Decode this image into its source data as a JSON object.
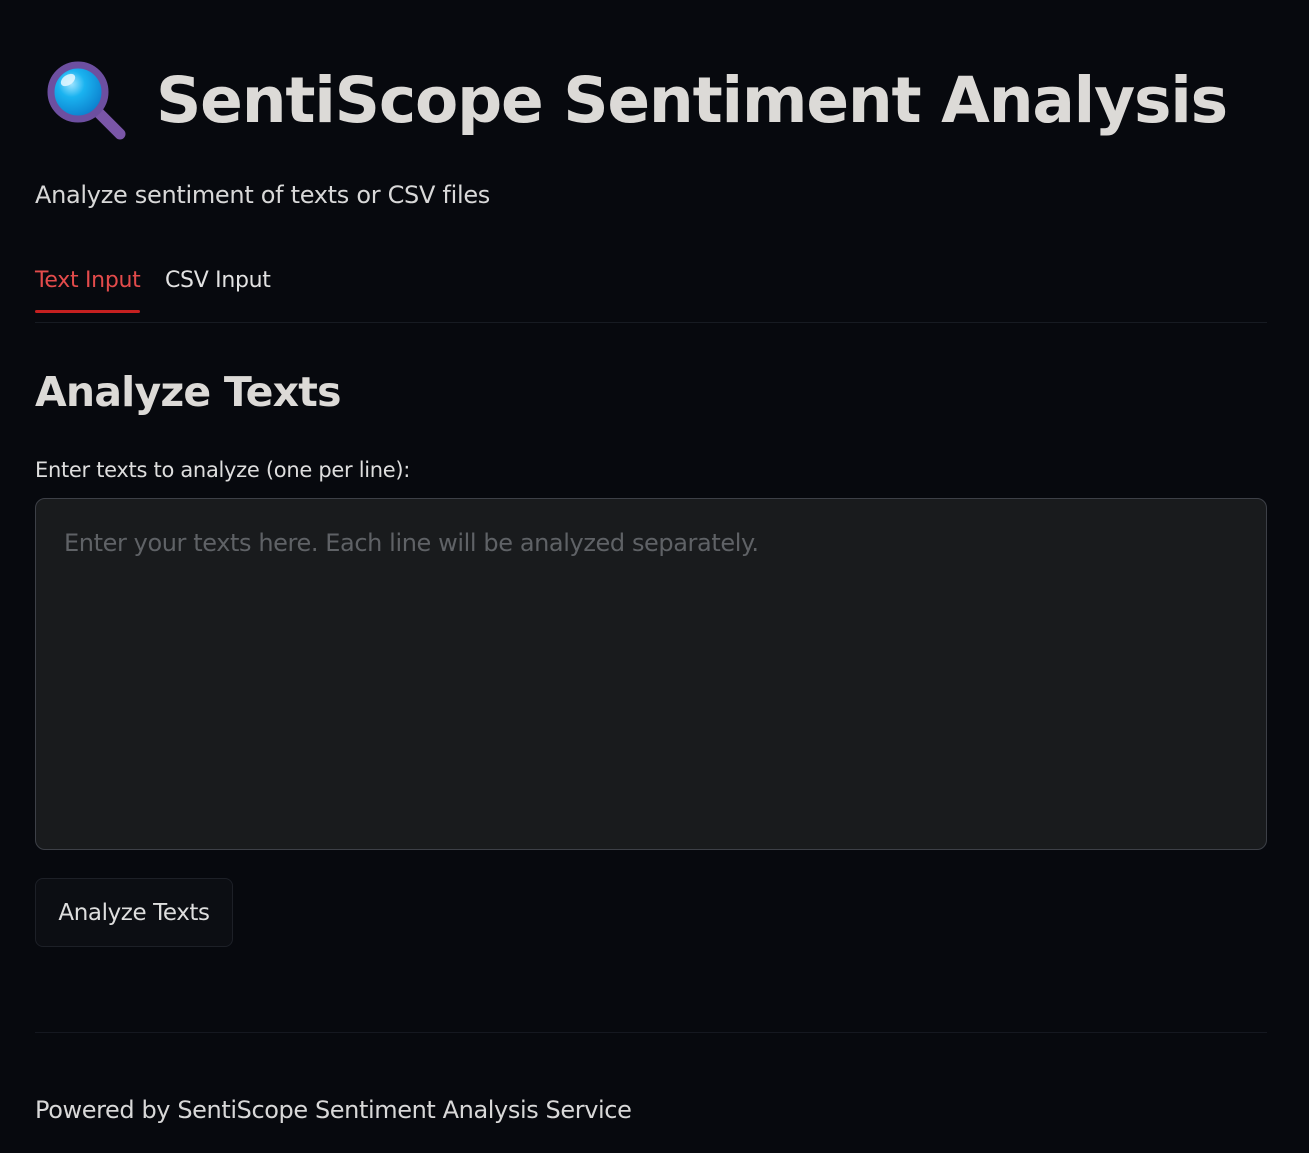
{
  "header": {
    "icon": "magnifying-glass-icon",
    "title": "SentiScope Sentiment Analysis",
    "subtitle": "Analyze sentiment of texts or CSV files"
  },
  "tabs": [
    {
      "label": "Text Input",
      "active": true
    },
    {
      "label": "CSV Input",
      "active": false
    }
  ],
  "main": {
    "heading": "Analyze Texts",
    "input_label": "Enter texts to analyze (one per line):",
    "input_value": "",
    "input_placeholder": "Enter your texts here. Each line will be analyzed separately.",
    "submit_label": "Analyze Texts"
  },
  "footer": {
    "text": "Powered by SentiScope Sentiment Analysis Service"
  },
  "colors": {
    "background": "#07090e",
    "accent": "#e34b4b",
    "accent_underline": "#c52020",
    "input_background": "#191b1d"
  }
}
